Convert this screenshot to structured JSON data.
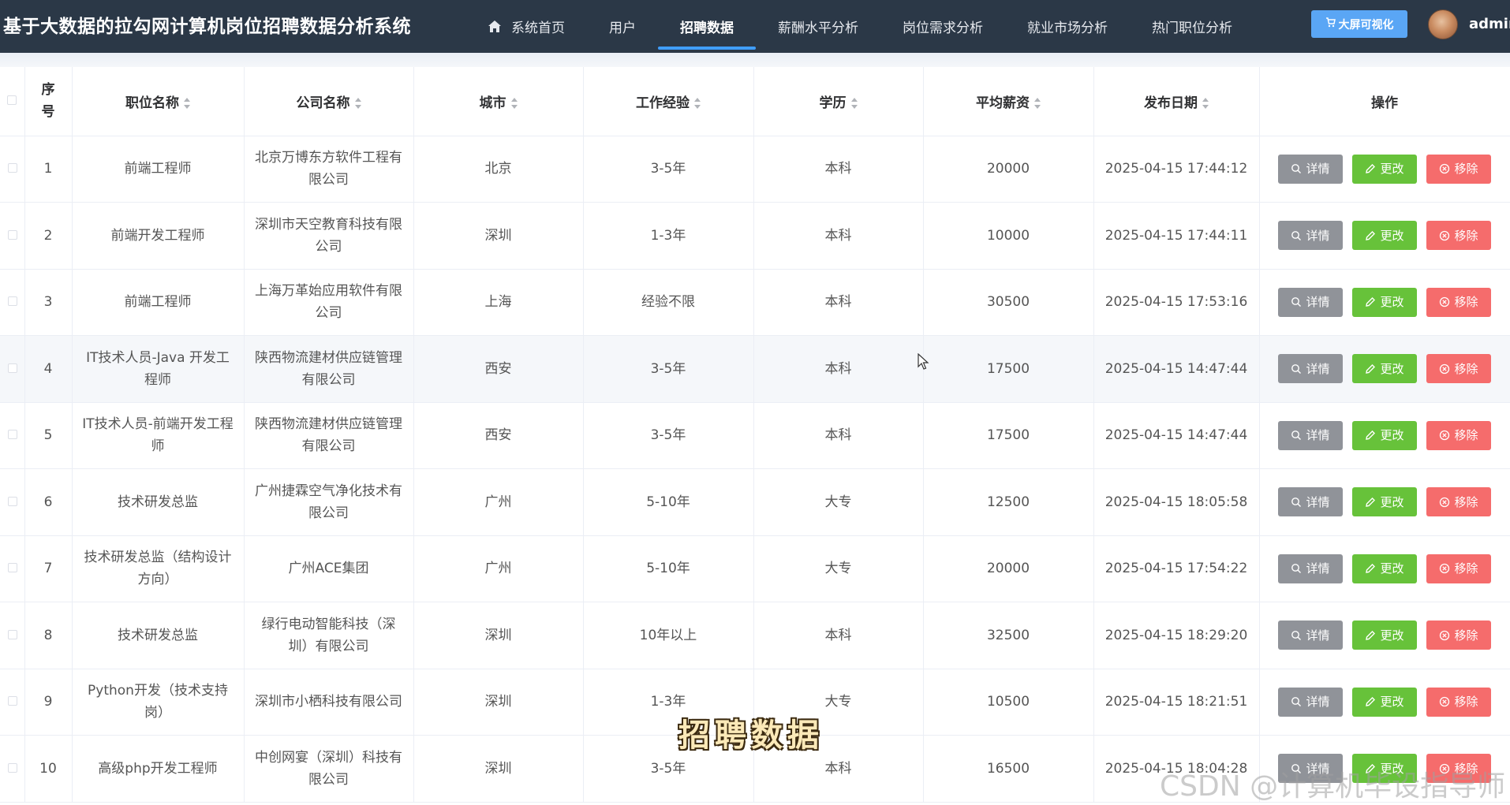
{
  "header": {
    "title": "基于大数据的拉勾网计算机岗位招聘数据分析系统",
    "nav": [
      {
        "label": "系统首页",
        "icon": "home-icon",
        "active": false
      },
      {
        "label": "用户",
        "active": false
      },
      {
        "label": "招聘数据",
        "active": true
      },
      {
        "label": "薪酬水平分析",
        "active": false
      },
      {
        "label": "岗位需求分析",
        "active": false
      },
      {
        "label": "就业市场分析",
        "active": false
      },
      {
        "label": "热门职位分析",
        "active": false
      }
    ],
    "bigscreen_label": "大屏可视化",
    "username": "admin"
  },
  "table": {
    "columns": [
      "序号",
      "职位名称",
      "公司名称",
      "城市",
      "工作经验",
      "学历",
      "平均薪资",
      "发布日期",
      "操作"
    ],
    "rows": [
      {
        "no": "1",
        "title": "前端工程师",
        "company": "北京万博东方软件工程有限公司",
        "city": "北京",
        "exp": "3-5年",
        "edu": "本科",
        "salary": "20000",
        "date": "2025-04-15 17:44:12"
      },
      {
        "no": "2",
        "title": "前端开发工程师",
        "company": "深圳市天空教育科技有限公司",
        "city": "深圳",
        "exp": "1-3年",
        "edu": "本科",
        "salary": "10000",
        "date": "2025-04-15 17:44:11"
      },
      {
        "no": "3",
        "title": "前端工程师",
        "company": "上海万革始应用软件有限公司",
        "city": "上海",
        "exp": "经验不限",
        "edu": "本科",
        "salary": "30500",
        "date": "2025-04-15 17:53:16"
      },
      {
        "no": "4",
        "title": "IT技术人员-Java 开发工程师",
        "company": "陕西物流建材供应链管理有限公司",
        "city": "西安",
        "exp": "3-5年",
        "edu": "本科",
        "salary": "17500",
        "date": "2025-04-15 14:47:44"
      },
      {
        "no": "5",
        "title": "IT技术人员-前端开发工程师",
        "company": "陕西物流建材供应链管理有限公司",
        "city": "西安",
        "exp": "3-5年",
        "edu": "本科",
        "salary": "17500",
        "date": "2025-04-15 14:47:44"
      },
      {
        "no": "6",
        "title": "技术研发总监",
        "company": "广州捷霖空气净化技术有限公司",
        "city": "广州",
        "exp": "5-10年",
        "edu": "大专",
        "salary": "12500",
        "date": "2025-04-15 18:05:58"
      },
      {
        "no": "7",
        "title": "技术研发总监（结构设计方向）",
        "company": "广州ACE集团",
        "city": "广州",
        "exp": "5-10年",
        "edu": "大专",
        "salary": "20000",
        "date": "2025-04-15 17:54:22"
      },
      {
        "no": "8",
        "title": "技术研发总监",
        "company": "绿行电动智能科技（深圳）有限公司",
        "city": "深圳",
        "exp": "10年以上",
        "edu": "本科",
        "salary": "32500",
        "date": "2025-04-15 18:29:20"
      },
      {
        "no": "9",
        "title": "Python开发（技术支持岗）",
        "company": "深圳市小栖科技有限公司",
        "city": "深圳",
        "exp": "1-3年",
        "edu": "大专",
        "salary": "10500",
        "date": "2025-04-15 18:21:51"
      },
      {
        "no": "10",
        "title": "高级php开发工程师",
        "company": "中创网宴（深圳）科技有限公司",
        "city": "深圳",
        "exp": "3-5年",
        "edu": "本科",
        "salary": "16500",
        "date": "2025-04-15 18:04:28"
      }
    ],
    "actions": {
      "detail": "详情",
      "edit": "更改",
      "delete": "移除"
    }
  },
  "overlay": {
    "caption": "招聘数据",
    "watermark": "CSDN @计算机毕设指导师"
  },
  "colors": {
    "header_bg": "#2b3847",
    "active_underline": "#409eff",
    "detail_btn": "#909399",
    "edit_btn": "#67c23a",
    "delete_btn": "#f56c6c",
    "bigscreen_btn": "#5aa6f5"
  }
}
